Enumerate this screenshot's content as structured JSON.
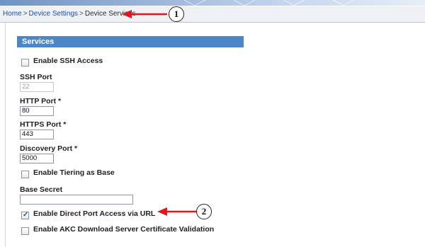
{
  "breadcrumb": {
    "home": "Home",
    "device_settings": "Device Settings",
    "device_services": "Device Services",
    "separator": ">"
  },
  "panel": {
    "title": "Services"
  },
  "form": {
    "enable_ssh": {
      "label": "Enable SSH Access",
      "checked": false
    },
    "ssh_port": {
      "label": "SSH Port",
      "value": "22",
      "disabled": true
    },
    "http_port": {
      "label": "HTTP Port *",
      "value": "80"
    },
    "https_port": {
      "label": "HTTPS Port *",
      "value": "443"
    },
    "discovery_port": {
      "label": "Discovery Port *",
      "value": "5000"
    },
    "enable_tiering": {
      "label": "Enable Tiering as Base",
      "checked": false
    },
    "base_secret": {
      "label": "Base Secret",
      "value": ""
    },
    "direct_port_access": {
      "label": "Enable Direct Port Access via URL",
      "checked": true
    },
    "akc_validation": {
      "label": "Enable AKC Download Server Certificate Validation",
      "checked": false
    }
  },
  "callouts": {
    "one": "1",
    "two": "2"
  },
  "colors": {
    "header_blue": "#4a86c8",
    "arrow_red": "#e3161c",
    "link_blue": "#1a4fb0"
  }
}
